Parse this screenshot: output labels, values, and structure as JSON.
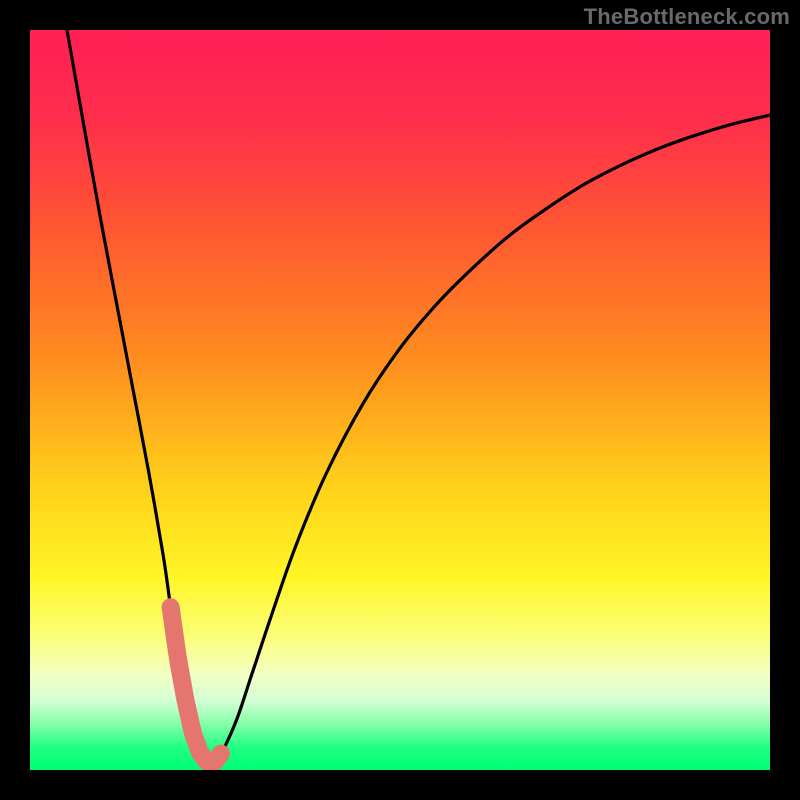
{
  "watermark": "TheBottleneck.com",
  "colors": {
    "frame": "#000000",
    "curve": "#000000",
    "overlay_stroke": "#e5766f",
    "gradient_stops": [
      {
        "offset": 0.0,
        "color": "#ff1f55"
      },
      {
        "offset": 0.12,
        "color": "#ff2e4b"
      },
      {
        "offset": 0.28,
        "color": "#ff5a30"
      },
      {
        "offset": 0.45,
        "color": "#ff8f1e"
      },
      {
        "offset": 0.62,
        "color": "#ffd21a"
      },
      {
        "offset": 0.74,
        "color": "#fff526"
      },
      {
        "offset": 0.82,
        "color": "#fcff7a"
      },
      {
        "offset": 0.87,
        "color": "#f3ffc2"
      },
      {
        "offset": 0.905,
        "color": "#d6ffd6"
      },
      {
        "offset": 0.94,
        "color": "#7fffa6"
      },
      {
        "offset": 0.97,
        "color": "#1eff82"
      },
      {
        "offset": 1.0,
        "color": "#00ff73"
      }
    ]
  },
  "chart_data": {
    "type": "line",
    "title": "",
    "xlabel": "",
    "ylabel": "",
    "xlim": [
      0,
      100
    ],
    "ylim": [
      0,
      100
    ],
    "x": [
      5,
      8,
      10,
      12,
      14,
      16,
      18,
      19,
      20,
      21,
      22,
      23,
      24,
      25,
      26,
      28,
      30,
      33,
      36,
      40,
      45,
      50,
      55,
      60,
      65,
      70,
      75,
      80,
      85,
      90,
      95,
      100
    ],
    "values": [
      100,
      83,
      72,
      61.5,
      51,
      40.5,
      29,
      22,
      15,
      9.5,
      5,
      2.3,
      1,
      1.1,
      2.5,
      7,
      13,
      22,
      30.5,
      40,
      49.5,
      57,
      63,
      68,
      72.4,
      76,
      79.2,
      81.8,
      84,
      85.8,
      87.3,
      88.5
    ],
    "overlay_segment": {
      "x_range": [
        19.0,
        25.8
      ],
      "note": "thick salmon highlight around curve minimum"
    }
  }
}
